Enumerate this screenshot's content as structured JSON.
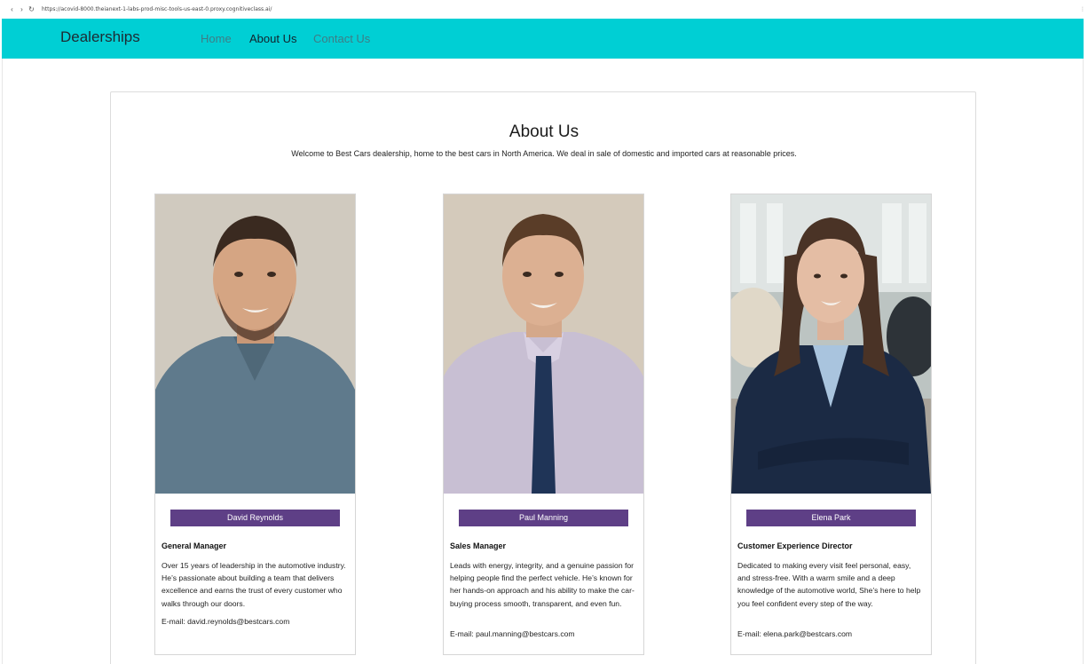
{
  "browser": {
    "back_glyph": "‹",
    "forward_glyph": "›",
    "reload_glyph": "↻",
    "url": "https://acovid-8000.theianext-1-labs-prod-misc-tools-us-east-0.proxy.cognitiveclass.ai/"
  },
  "navbar": {
    "brand": "Dealerships",
    "links": [
      {
        "label": "Home"
      },
      {
        "label": "About Us"
      },
      {
        "label": "Contact Us"
      }
    ],
    "color": "#00cfd4"
  },
  "page": {
    "title": "About Us",
    "intro": "Welcome to Best Cars dealership, home to the best cars in North America. We deal in sale of domestic and imported cars at reasonable prices."
  },
  "team": [
    {
      "name": "David Reynolds",
      "role": "General Manager",
      "bio": "Over 15 years of leadership in the automotive industry. He’s passionate about building a team that delivers excellence and earns the trust of every customer who walks through our doors.",
      "email": "E-mail: david.reynolds@bestcars.com"
    },
    {
      "name": "Paul Manning",
      "role": "Sales Manager",
      "bio": "Leads with energy, integrity, and a genuine passion for helping people find the perfect vehicle. He’s known for her hands-on approach and his ability to make the car-buying process smooth, transparent, and even fun.",
      "email": "E-mail: paul.manning@bestcars.com"
    },
    {
      "name": "Elena Park",
      "role": "Customer Experience Director",
      "bio": "Dedicated to making every visit feel personal, easy, and stress-free. With a warm smile and a deep knowledge of the automotive world, She’s here to help you feel confident every step of the way.",
      "email": "E-mail: elena.park@bestcars.com"
    }
  ],
  "colors": {
    "name_bar": "#5e3f86",
    "navbar": "#00cfd4"
  }
}
